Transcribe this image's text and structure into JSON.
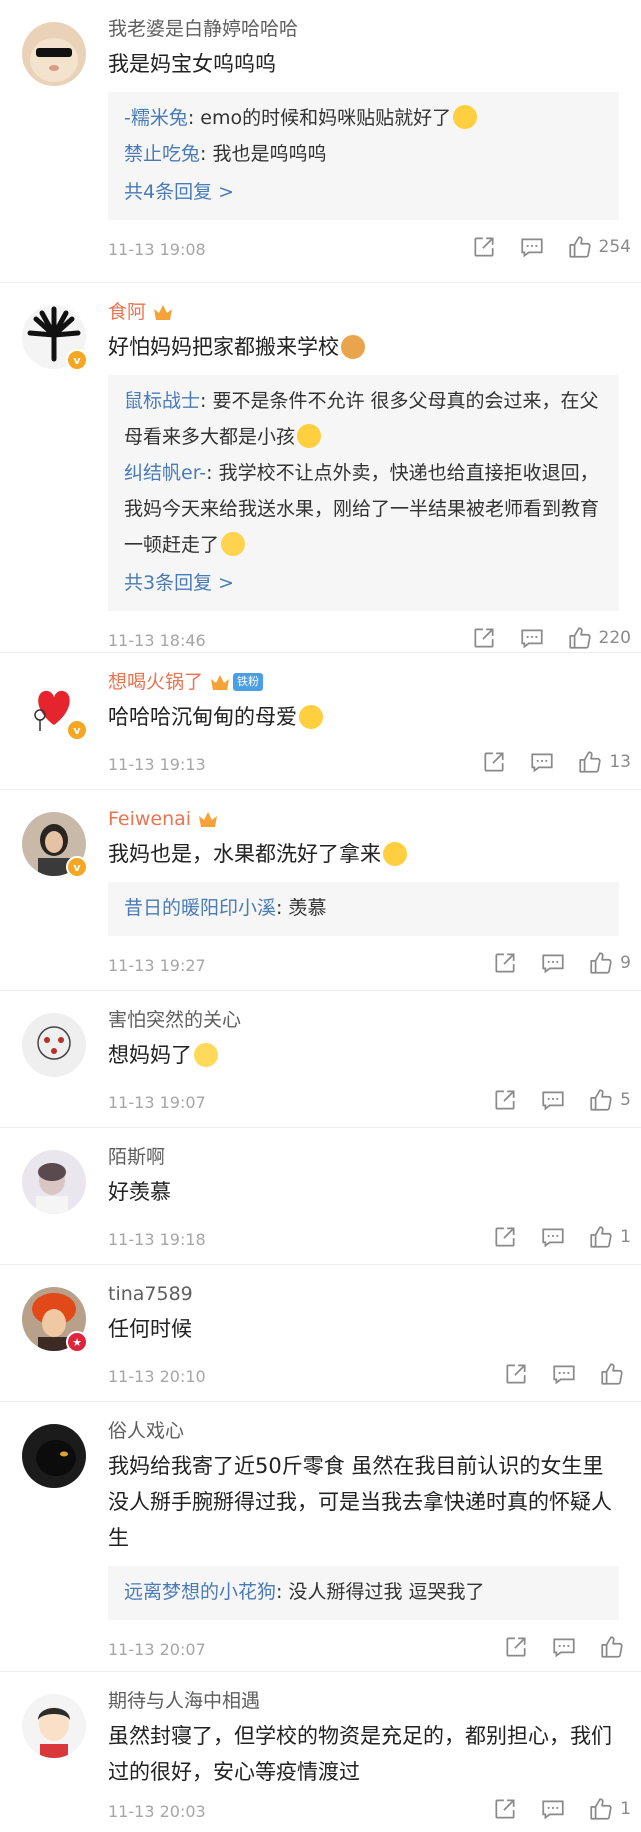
{
  "comments": [
    {
      "username": "我老婆是白静婷哈哈哈",
      "name_style": "normal",
      "text": "我是妈宝女呜呜呜",
      "replies": [
        {
          "user": "-糯米兔",
          "text": ": emo的时候和妈咪贴贴就好了"
        },
        {
          "user": "禁止吃兔",
          "text": ": 我也是呜呜呜"
        }
      ],
      "more": "共4条回复 >",
      "time": "11-13 19:08",
      "likes": "254"
    },
    {
      "username": "食阿",
      "name_style": "orange",
      "text": "好怕妈妈把家都搬来学校",
      "replies": [
        {
          "user": "鼠标战士",
          "text": ": 要不是条件不允许 很多父母真的会过来，在父母看来多大都是小孩"
        },
        {
          "user": "纠结帆er-",
          "text": ": 我学校不让点外卖，快递也给直接拒收退回，我妈今天来给我送水果，刚给了一半结果被老师看到教育一顿赶走了"
        }
      ],
      "more": "共3条回复 >",
      "time": "11-13 18:46",
      "likes": "220"
    },
    {
      "username": "想喝火锅了",
      "name_style": "orange",
      "fan_tag": "铁粉",
      "text": "哈哈哈沉甸甸的母爱",
      "replies": [],
      "more": "",
      "time": "11-13 19:13",
      "likes": "13"
    },
    {
      "username": "Feiwenai",
      "name_style": "orange",
      "text": "我妈也是，水果都洗好了拿来",
      "replies": [
        {
          "user": "昔日的暖阳印小溪",
          "text": ": 羡慕"
        }
      ],
      "more": "",
      "time": "11-13 19:27",
      "likes": "9"
    },
    {
      "username": "害怕突然的关心",
      "name_style": "normal",
      "text": "想妈妈了",
      "replies": [],
      "more": "",
      "time": "11-13 19:07",
      "likes": "5"
    },
    {
      "username": "陌斯啊",
      "name_style": "normal",
      "text": "好羡慕",
      "replies": [],
      "more": "",
      "time": "11-13 19:18",
      "likes": "1"
    },
    {
      "username": "tina7589",
      "name_style": "normal",
      "text": "任何时候",
      "replies": [],
      "more": "",
      "time": "11-13 20:10",
      "likes": ""
    },
    {
      "username": "俗人戏心",
      "name_style": "normal",
      "text": "我妈给我寄了近50斤零食 虽然在我目前认识的女生里没人掰手腕掰得过我，可是当我去拿快递时真的怀疑人生",
      "replies": [
        {
          "user": "远离梦想的小花狗",
          "text": ": 没人掰得过我 逗哭我了"
        }
      ],
      "more": "",
      "time": "11-13 20:07",
      "likes": ""
    },
    {
      "username": "期待与人海中相遇",
      "name_style": "normal",
      "text": "虽然封寝了，但学校的物资是充足的，都别担心，我们过的很好，安心等疫情渡过",
      "replies": [],
      "more": "",
      "time": "11-13 20:03",
      "likes": "1"
    }
  ]
}
